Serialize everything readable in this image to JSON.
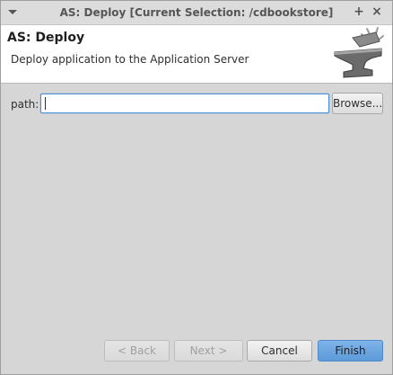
{
  "window": {
    "title": "AS: Deploy [Current Selection: /cdbookstore]",
    "menu_icon": "chevron-down-icon",
    "maximize_icon": "plus-icon",
    "close_icon": "close-icon"
  },
  "header": {
    "title": "AS: Deploy",
    "description": "Deploy application to the Application Server",
    "image_icon": "anvil-icon"
  },
  "form": {
    "path_label": "path:",
    "path_value": "",
    "browse_label": "Browse..."
  },
  "buttons": {
    "back_label": "< Back",
    "next_label": "Next >",
    "cancel_label": "Cancel",
    "finish_label": "Finish"
  },
  "colors": {
    "accent": "#5c9ad9",
    "focus_border": "#4a90d9"
  }
}
